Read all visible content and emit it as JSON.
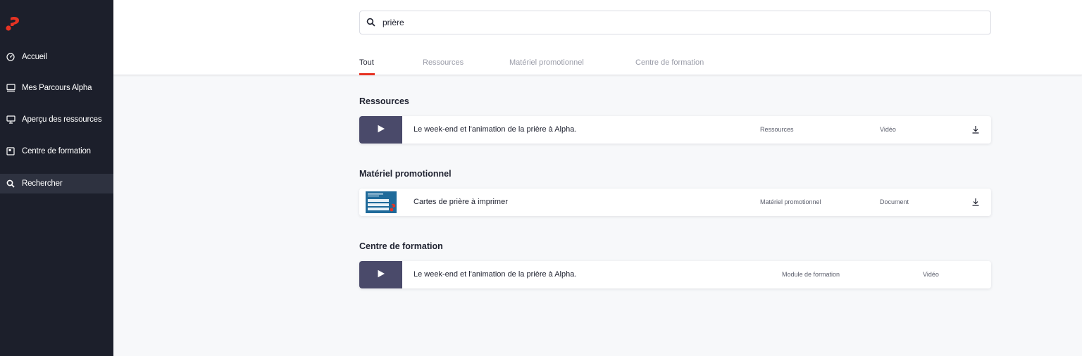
{
  "brand": {
    "logo_icon": "alpha-logo-icon",
    "accent": "#e63323"
  },
  "sidebar": {
    "items": [
      {
        "label": "Accueil",
        "icon": "dashboard-icon"
      },
      {
        "label": "Mes Parcours Alpha",
        "icon": "monitor-icon"
      },
      {
        "label": "Aperçu des ressources",
        "icon": "screen-icon"
      },
      {
        "label": "Centre de formation",
        "icon": "book-icon"
      },
      {
        "label": "Rechercher",
        "icon": "search-icon",
        "active": true
      }
    ]
  },
  "search": {
    "value": "prière",
    "placeholder": ""
  },
  "tabs": [
    {
      "label": "Tout",
      "active": true
    },
    {
      "label": "Ressources"
    },
    {
      "label": "Matériel promotionnel"
    },
    {
      "label": "Centre de formation"
    }
  ],
  "sections": [
    {
      "title": "Ressources",
      "item": {
        "title": "Le week-end et l'animation de la prière à Alpha.",
        "category": "Ressources",
        "kind": "Vidéo",
        "thumb": "play-icon",
        "download": true
      }
    },
    {
      "title": "Matériel promotionnel",
      "item": {
        "title": "Cartes de prière à imprimer",
        "category": "Matériel promotionnel",
        "kind": "Document",
        "thumb": "document-thumbnail",
        "download": true
      }
    },
    {
      "title": "Centre de formation",
      "item": {
        "title": "Le week-end et l'animation de la prière à Alpha.",
        "category": "Module de formation",
        "kind": "Vidéo",
        "thumb": "play-icon",
        "download": false
      }
    }
  ]
}
